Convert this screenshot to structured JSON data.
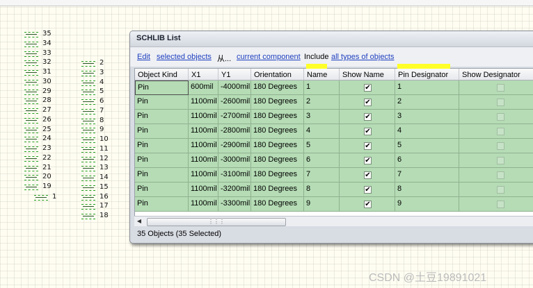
{
  "canvas": {
    "pins_left": [
      "35",
      "34",
      "33",
      "32",
      "31",
      "30",
      "29",
      "28",
      "27",
      "26",
      "25",
      "24",
      "23",
      "22",
      "21",
      "20",
      "19",
      "1"
    ],
    "pins_right": [
      "2",
      "3",
      "4",
      "5",
      "6",
      "7",
      "8",
      "9",
      "10",
      "11",
      "12",
      "13",
      "14",
      "15",
      "16",
      "17",
      "18"
    ]
  },
  "panel": {
    "title": "SCHLIB List",
    "toolbar": {
      "edit": "Edit",
      "selected_objects": "selected objects",
      "from_icon": "从...",
      "current_component": "current component",
      "include": "Include",
      "all_types": "all types of objects"
    },
    "columns": [
      "Object Kind",
      "X1",
      "Y1",
      "Orientation",
      "Name",
      "Show Name",
      "Pin Designator",
      "Show Designator"
    ],
    "rows": [
      {
        "kind": "Pin",
        "x1": "600mil",
        "y1": "-4000mil",
        "orientation": "180 Degrees",
        "name": "1",
        "show_name": true,
        "designator": "1",
        "show_designator": false
      },
      {
        "kind": "Pin",
        "x1": "1100mil",
        "y1": "-2600mil",
        "orientation": "180 Degrees",
        "name": "2",
        "show_name": true,
        "designator": "2",
        "show_designator": false
      },
      {
        "kind": "Pin",
        "x1": "1100mil",
        "y1": "-2700mil",
        "orientation": "180 Degrees",
        "name": "3",
        "show_name": true,
        "designator": "3",
        "show_designator": false
      },
      {
        "kind": "Pin",
        "x1": "1100mil",
        "y1": "-2800mil",
        "orientation": "180 Degrees",
        "name": "4",
        "show_name": true,
        "designator": "4",
        "show_designator": false
      },
      {
        "kind": "Pin",
        "x1": "1100mil",
        "y1": "-2900mil",
        "orientation": "180 Degrees",
        "name": "5",
        "show_name": true,
        "designator": "5",
        "show_designator": false
      },
      {
        "kind": "Pin",
        "x1": "1100mil",
        "y1": "-3000mil",
        "orientation": "180 Degrees",
        "name": "6",
        "show_name": true,
        "designator": "6",
        "show_designator": false
      },
      {
        "kind": "Pin",
        "x1": "1100mil",
        "y1": "-3100mil",
        "orientation": "180 Degrees",
        "name": "7",
        "show_name": true,
        "designator": "7",
        "show_designator": false
      },
      {
        "kind": "Pin",
        "x1": "1100mil",
        "y1": "-3200mil",
        "orientation": "180 Degrees",
        "name": "8",
        "show_name": true,
        "designator": "8",
        "show_designator": false
      },
      {
        "kind": "Pin",
        "x1": "1100mil",
        "y1": "-3300mil",
        "orientation": "180 Degrees",
        "name": "9",
        "show_name": true,
        "designator": "9",
        "show_designator": false
      }
    ],
    "status": "35 Objects (35 Selected)"
  },
  "watermark": "CSDN @土豆19891021"
}
